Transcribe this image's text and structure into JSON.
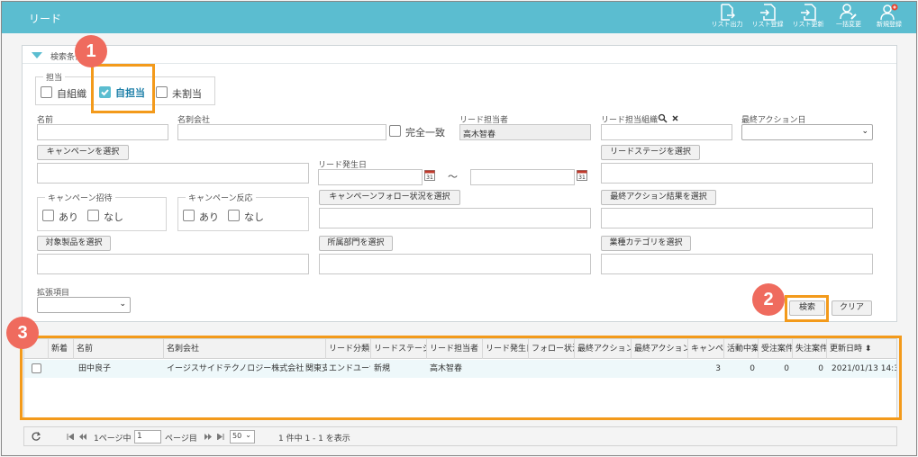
{
  "app": {
    "title": "リード"
  },
  "toolbar": {
    "list_output": "リスト出力",
    "list_register": "リスト登録",
    "list_update": "リスト更新",
    "bulk_change": "一括変更",
    "new_register": "新規登録"
  },
  "search": {
    "panel_title": "検索条件",
    "owner_group": {
      "legend": "担当",
      "my_org": "自組織",
      "mine": "自担当",
      "unassigned": "未割当"
    },
    "name_label": "名前",
    "card_company_label": "名刺会社",
    "exact_match": "完全一致",
    "lead_owner_label": "リード担当者",
    "lead_owner_value": "高木智春",
    "lead_owner_org_label": "リード担当組織",
    "last_action_date_label": "最終アクション日",
    "campaign_button": "キャンペーンを選択",
    "lead_date_label": "リード発生日",
    "date_tilde": "～",
    "lead_stage_button": "リードステージを選択",
    "campaign_invite": {
      "legend": "キャンペーン招待",
      "yes": "あり",
      "no": "なし"
    },
    "campaign_response": {
      "legend": "キャンペーン反応",
      "yes": "あり",
      "no": "なし"
    },
    "campaign_follow_button": "キャンペーンフォロー状況を選択",
    "last_action_result_button": "最終アクション結果を選択",
    "product_button": "対象製品を選択",
    "department_button": "所属部門を選択",
    "industry_button": "業種カテゴリを選択",
    "ext_label": "拡張項目",
    "search_button": "検索",
    "clear_button": "クリア"
  },
  "steps": {
    "one": "1",
    "two": "2",
    "three": "3"
  },
  "grid": {
    "headers": [
      "新着",
      "名前",
      "名刺会社",
      "リード分類",
      "リードステージ",
      "リード担当者",
      "リード発生日",
      "フォロー状況",
      "最終アクション",
      "最終アクション",
      "キャンペーン",
      "活動中案件",
      "受注案件",
      "失注案件",
      "更新日時"
    ],
    "sort_glyph": "⬍",
    "row": {
      "new": "",
      "name": "田中良子",
      "company": "イージスサイドテクノロジー株式会社",
      "category": "関東支社",
      "stage_type": "エンドユーザー",
      "stage": "新規",
      "owner": "高木智春",
      "lead_date": "",
      "follow": "",
      "last_action1": "",
      "last_action2": "",
      "campaign": "3",
      "active": "0",
      "won": "0",
      "lost": "0",
      "updated": "2021/01/13 14:3"
    }
  },
  "pager": {
    "page_prefix": "1ページ中",
    "page_value": "1",
    "page_suffix": "ページ目",
    "per_page": "50",
    "summary": "1 件中 1 - 1 を表示"
  },
  "colors": {
    "accent": "#5bbdd0",
    "highlight": "#f39a1b",
    "step_badge": "#ef6b5e"
  }
}
